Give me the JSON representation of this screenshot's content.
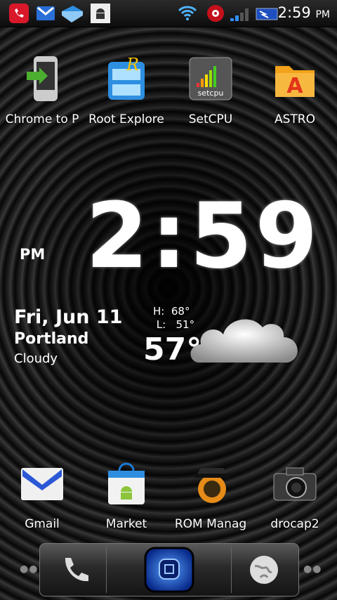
{
  "status_bar": {
    "time": "2:59",
    "ampm": "PM"
  },
  "top_row_apps": [
    {
      "label": "Chrome to P",
      "icon": "phone-arrow-icon"
    },
    {
      "label": "Root Explore",
      "icon": "file-cabinet-icon"
    },
    {
      "label": "SetCPU",
      "icon": "setcpu-icon"
    },
    {
      "label": "ASTRO",
      "icon": "folder-icon"
    }
  ],
  "clock": {
    "time": "2:59",
    "ampm": "PM"
  },
  "weather": {
    "date": "Fri, Jun 11",
    "city": "Portland",
    "condition": "Cloudy",
    "high_label": "H:",
    "high": "68°",
    "low_label": "L:",
    "low": "51°",
    "temp": "57°"
  },
  "bottom_row_apps": [
    {
      "label": "Gmail",
      "icon": "gmail-envelope-icon"
    },
    {
      "label": "Market",
      "icon": "market-bag-icon"
    },
    {
      "label": "ROM Manag",
      "icon": "rom-manager-icon"
    },
    {
      "label": "drocap2",
      "icon": "camera-icon"
    }
  ],
  "dock": {
    "left": "phone-icon",
    "center": "app-drawer-icon",
    "right": "globe-icon"
  },
  "colors": {
    "wifi": "#4fb3ff",
    "signal": "#2f8fff"
  }
}
